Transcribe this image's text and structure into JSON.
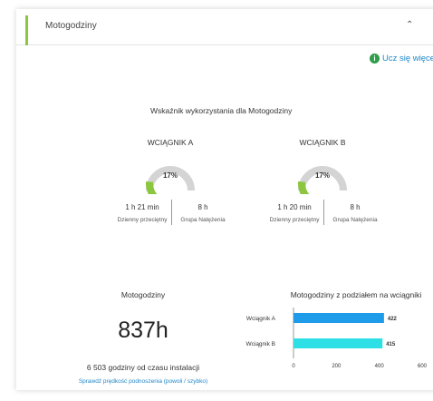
{
  "header": {
    "title": "Motogodziny",
    "collapse_icon": "chevron-up-icon"
  },
  "learn_more": {
    "label": "Ucz się więcej",
    "icon": "info-icon",
    "icon_color": "#2e9e4a"
  },
  "usage": {
    "title": "Wskaźnik wykorzystania dla Motogodziny",
    "hoists": [
      {
        "name": "WCIĄGNIK A",
        "percent": 17,
        "percent_label": "17%",
        "daily_avg": "1 h 21 min",
        "daily_avg_label": "Dzienny przeciętny",
        "group": "8 h",
        "group_label": "Grupa Natężenia"
      },
      {
        "name": "WCIĄGNIK B",
        "percent": 17,
        "percent_label": "17%",
        "daily_avg": "1 h 20 min",
        "daily_avg_label": "Dzienny przeciętny",
        "group": "8 h",
        "group_label": "Grupa Natężenia"
      }
    ],
    "gauge_fill_color": "#8cc63f",
    "gauge_track_color": "#d4d4d4"
  },
  "motohours": {
    "title": "Motogodziny",
    "total": "837h",
    "since_install": "6 503 godziny od czasu instalacji",
    "speed_link": "Sprawdź prędkość podnoszenia (powoli / szybko)"
  },
  "chart_data": {
    "type": "bar",
    "orientation": "horizontal",
    "title": "Motogodziny z podziałem na wciągniki",
    "categories": [
      "Wciągnik A",
      "Wciągnik B"
    ],
    "values": [
      422,
      415
    ],
    "value_labels": [
      "422",
      "415"
    ],
    "colors": [
      "#1e9be9",
      "#2ee0e6"
    ],
    "xlim": [
      0,
      600
    ],
    "x_ticks": [
      "0",
      "200",
      "400",
      "600"
    ],
    "grid": false
  }
}
